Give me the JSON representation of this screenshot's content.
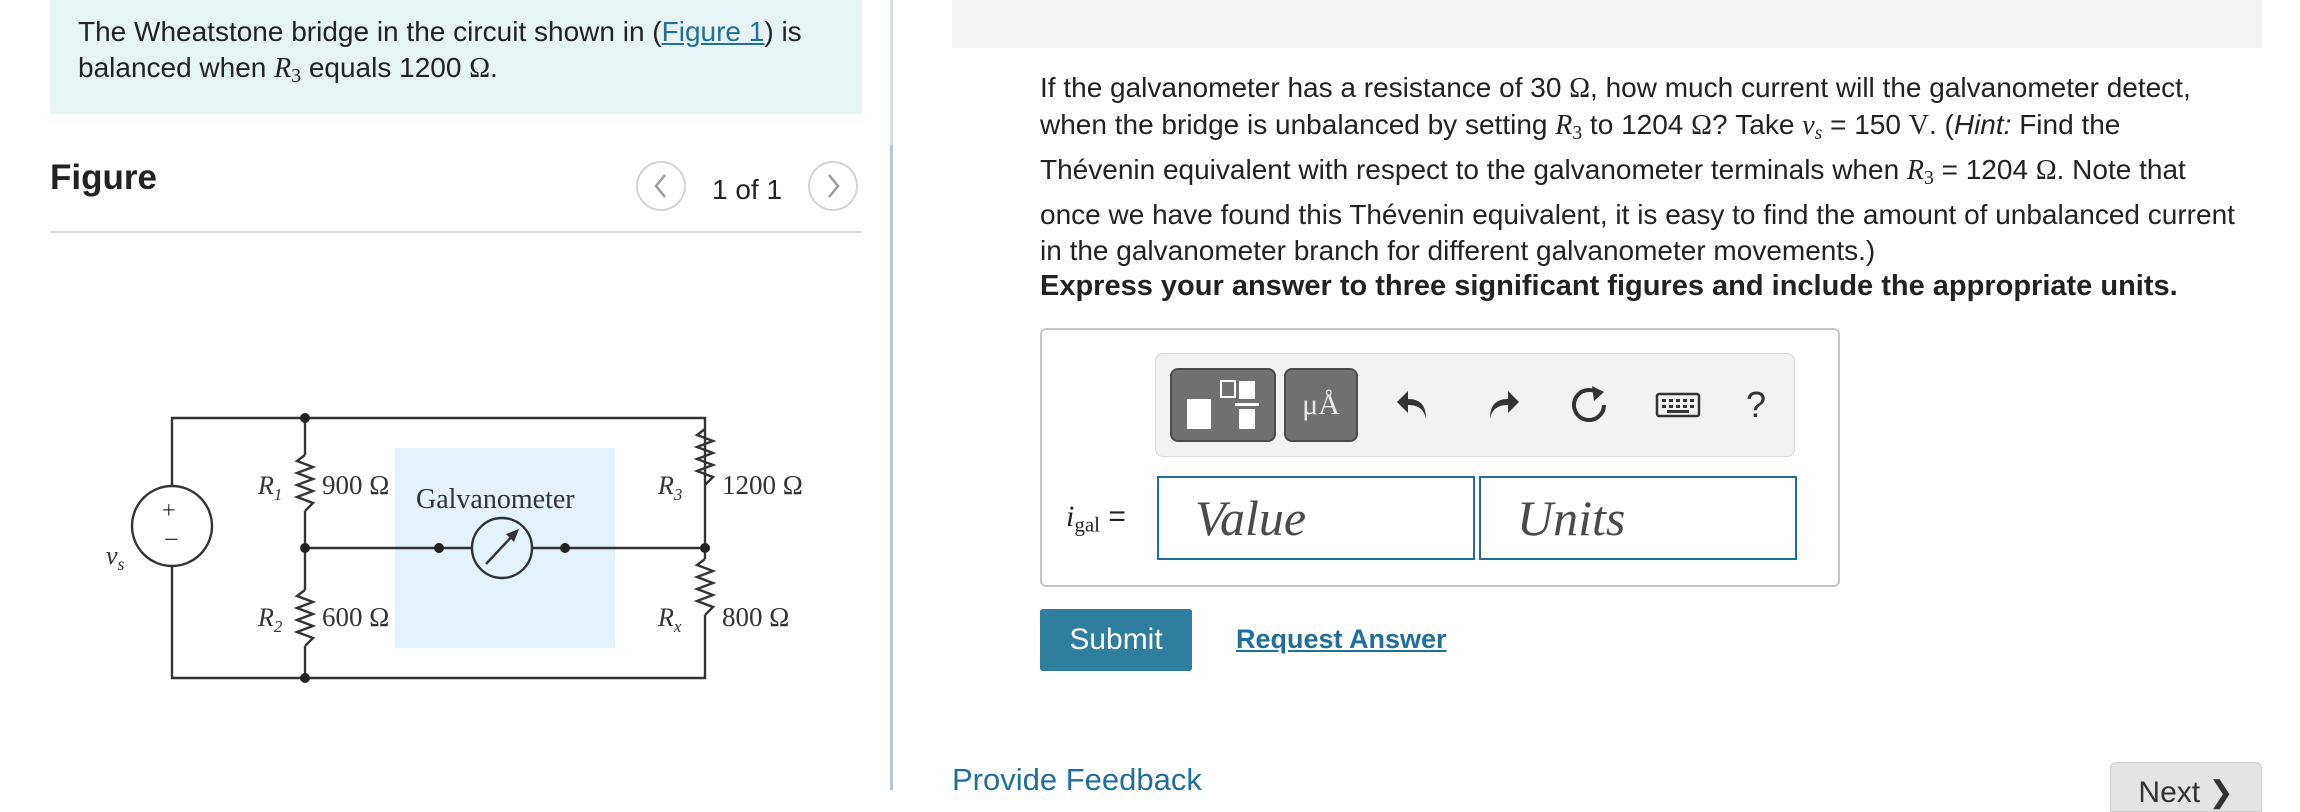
{
  "intro": {
    "part1": "The Wheatstone bridge in the circuit shown in (",
    "figure_link": "Figure 1",
    "part2": ") is balanced when ",
    "r_var": "R",
    "r_sub": "3",
    "part3": " equals 1200 ",
    "ohm": "Ω",
    "part4": "."
  },
  "figure": {
    "heading": "Figure",
    "counter": "1 of 1",
    "circuit": {
      "r1_label": "R",
      "r1_sub": "1",
      "r1_value": "900 Ω",
      "r2_label": "R",
      "r2_sub": "2",
      "r2_value": "600 Ω",
      "r3_label": "R",
      "r3_sub": "3",
      "r3_value": "1200 Ω",
      "rx_label": "R",
      "rx_sub": "x",
      "rx_value": "800 Ω",
      "galvanometer_label": "Galvanometer",
      "source_label": "v",
      "source_sub": "s",
      "plus": "+",
      "minus": "−",
      "accent_color": "#e3f2fb"
    }
  },
  "question": {
    "t1": "If the galvanometer has a resistance of 30 ",
    "ohm1": "Ω",
    "t2": ", how much current will the galvanometer detect, when the bridge is unbalanced by setting ",
    "r3a_var": "R",
    "r3a_sub": "3",
    "t3": " to 1204 ",
    "ohm2": "Ω",
    "t4": "? Take ",
    "vs_var": "v",
    "vs_sub": "s",
    "t5": " = 150 ",
    "volt": "V",
    "t6": ". (",
    "hint": "Hint:",
    "t7": " Find the Thévenin  equivalent with respect to the galvanometer terminals when ",
    "r3b_var": "R",
    "r3b_sub": "3",
    "t8": " = 1204 ",
    "ohm3": "Ω",
    "t9": ". Note that once we have found this Thévenin equivalent, it is easy to find the amount of unbalanced current in the galvanometer branch for different galvanometer movements.)"
  },
  "instruction": "Express your answer to three significant figures and include the appropriate units.",
  "toolbar": {
    "template_icon": "fraction-template-icon",
    "symbols_label": "μÅ",
    "undo_icon": "undo-icon",
    "redo_icon": "redo-icon",
    "reset_icon": "reset-icon",
    "keyboard_icon": "keyboard-icon",
    "help_label": "?"
  },
  "answer": {
    "label_var": "i",
    "label_sub": "gal",
    "label_eq": " =",
    "value_placeholder": "Value",
    "units_placeholder": "Units"
  },
  "actions": {
    "submit": "Submit",
    "request_answer": "Request Answer",
    "provide_feedback": "Provide Feedback",
    "next": "Next ❯"
  },
  "colors": {
    "accent": "#2f7e9f",
    "link": "#1f6f9a",
    "intro_bg": "#e6f4f6"
  }
}
